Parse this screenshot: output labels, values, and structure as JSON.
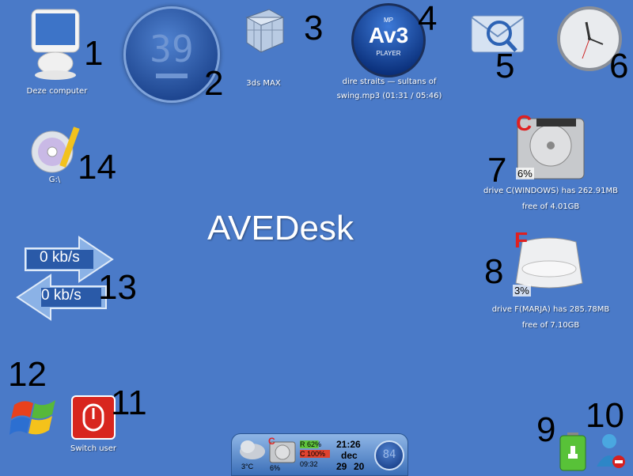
{
  "title": "AVEDesk",
  "icons": {
    "computer": {
      "label": "Deze computer",
      "number": "1"
    },
    "countdown": {
      "value": "39",
      "number": "2"
    },
    "max": {
      "label": "3ds MAX",
      "number": "3"
    },
    "player": {
      "logo": "Av3",
      "sublogo": "PLAYER",
      "mp": "MP",
      "now_playing_line1": "dire straits — sultans of",
      "now_playing_line2": "swing.mp3 (01:31 / 05:46)",
      "number": "4"
    },
    "mail": {
      "number": "5"
    },
    "clock": {
      "number": "6"
    },
    "drive_c": {
      "letter": "C",
      "percent": "6%",
      "caption_line1": "drive C(WINDOWS) has 262.91MB",
      "caption_line2": "free of 4.01GB",
      "number": "7"
    },
    "drive_f": {
      "letter": "F",
      "percent": "3%",
      "caption_line1": "drive F(MARJA) has 285.78MB",
      "caption_line2": "free of 7.10GB",
      "number": "8"
    },
    "battery": {
      "number": "9"
    },
    "messenger": {
      "number": "10"
    },
    "switch_user": {
      "label": "Switch user",
      "number": "11"
    },
    "windows": {
      "number": "12"
    },
    "network": {
      "upload": "0 kb/s",
      "download": "0 kb/s",
      "number": "13"
    },
    "cd": {
      "label": "G:\\",
      "number": "14"
    }
  },
  "taskbar": {
    "weather_temp": "3°C",
    "drive_letter": "C",
    "drive_pct": "6%",
    "ram": "R 62%",
    "cpu": "C 100%",
    "uptime": "09:32",
    "time": "21:26",
    "month": "dec",
    "day": "29",
    "year": "20",
    "badge": "84"
  }
}
